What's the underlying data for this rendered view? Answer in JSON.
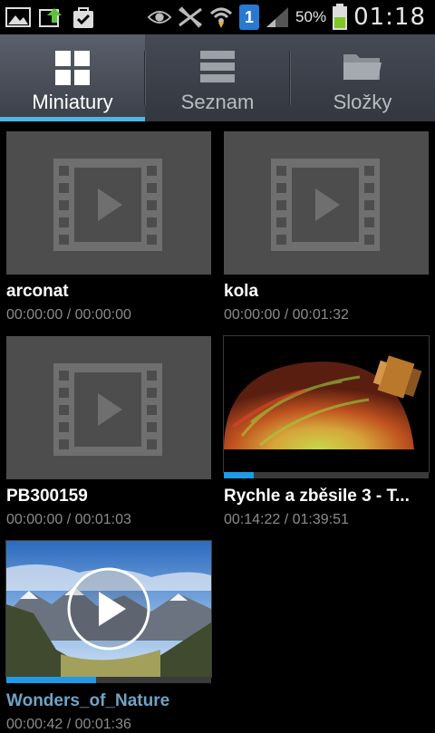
{
  "status_bar": {
    "battery_percent": "50%",
    "clock": "01:18",
    "notification_badge": "1",
    "icons": [
      "gallery-icon",
      "upload-icon",
      "task-icon",
      "eye-icon",
      "no-signal-icon",
      "wifi-icon",
      "sim-badge-icon",
      "signal-icon",
      "battery-icon"
    ]
  },
  "tabs": [
    {
      "label": "Miniatury",
      "icon": "grid-icon",
      "selected": true
    },
    {
      "label": "Seznam",
      "icon": "list-icon",
      "selected": false
    },
    {
      "label": "Složky",
      "icon": "folder-icon",
      "selected": false
    }
  ],
  "videos": [
    {
      "title": "arconat",
      "duration": "00:00:00 / 00:00:00",
      "thumbnail": "placeholder"
    },
    {
      "title": "kola",
      "duration": "00:00:00 / 00:01:32",
      "thumbnail": "placeholder"
    },
    {
      "title": "PB300159",
      "duration": "00:00:00 / 00:01:03",
      "thumbnail": "placeholder"
    },
    {
      "title": "Rychle a zběsile 3 - T...",
      "duration": "00:14:22 / 01:39:51",
      "thumbnail": "space-scene",
      "progress": 0.144
    },
    {
      "title": "Wonders_of_Nature",
      "duration": "00:00:42 / 00:01:36",
      "thumbnail": "mountain-scene",
      "progress": 0.44,
      "playing": true
    }
  ],
  "colors": {
    "accent": "#4eb6e6",
    "progress": "#1f9ae6",
    "playing_title": "#6fa3c4"
  }
}
